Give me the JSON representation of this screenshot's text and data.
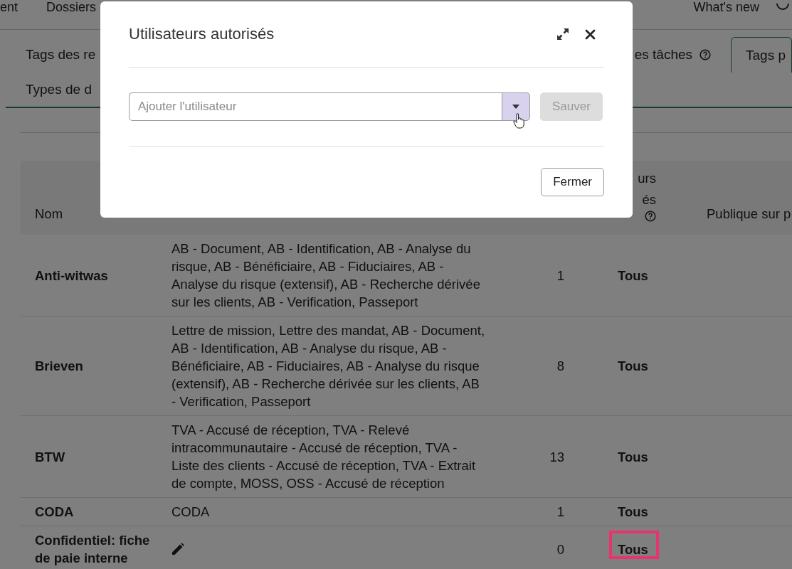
{
  "top_nav": {
    "items": [
      {
        "label": "ent"
      },
      {
        "label": "Dossiers"
      }
    ],
    "right_items": [
      {
        "label": "What's new"
      }
    ]
  },
  "tabs": {
    "rows": [
      [
        {
          "label": "Tags des re",
          "selected": false,
          "help": false
        },
        {
          "label": "es tâches",
          "selected": false,
          "help": true
        },
        {
          "label": "Tags p",
          "selected": true,
          "help": false
        }
      ],
      [
        {
          "label": "Types de d",
          "selected": false,
          "help": false
        }
      ]
    ]
  },
  "table": {
    "header": {
      "column_1": "Nom",
      "column_4": {
        "lines": [
          "urs",
          "és"
        ],
        "help": true
      },
      "column_5": "Publique sur p"
    },
    "rows": [
      {
        "name": "Anti-witwas",
        "doc_types": "AB - Document, AB - Identification, AB - Analyse du risque, AB - Bénéficiaire, AB - Fiduciaires, AB - Analyse du risque (extensif), AB - Recherche dérivée sur les clients, AB - Verification, Passeport",
        "count": "1",
        "users": "Tous",
        "highlighted": false
      },
      {
        "name": "Brieven",
        "doc_types": "Lettre de mission, Lettre des mandat, AB - Document, AB - Identification, AB - Analyse du risque, AB - Bénéficiaire, AB - Fiduciaires, AB - Analyse du risque (extensif), AB - Recherche dérivée sur les clients, AB - Verification, Passeport",
        "count": "8",
        "users": "Tous",
        "highlighted": false
      },
      {
        "name": "BTW",
        "doc_types": "TVA - Accusé de réception, TVA - Relevé intracommunautaire - Accusé de réception, TVA - Liste des clients - Accusé de réception, TVA - Extrait de compte, MOSS, OSS - Accusé de réception",
        "count": "13",
        "users": "Tous",
        "highlighted": false
      },
      {
        "name": "CODA",
        "doc_types": "CODA",
        "count": "1",
        "users": "Tous",
        "highlighted": false
      },
      {
        "name": "Confidentiel: fiche de paie interne",
        "doc_types": null,
        "count": "0",
        "users": "Tous",
        "highlighted": true
      }
    ]
  },
  "modal": {
    "title": "Utilisateurs autorisés",
    "user_field": {
      "placeholder": "Ajouter l'utilisateur"
    },
    "save_button": {
      "label": "Sauver",
      "disabled": true
    },
    "close_button": {
      "label": "Fermer"
    }
  }
}
